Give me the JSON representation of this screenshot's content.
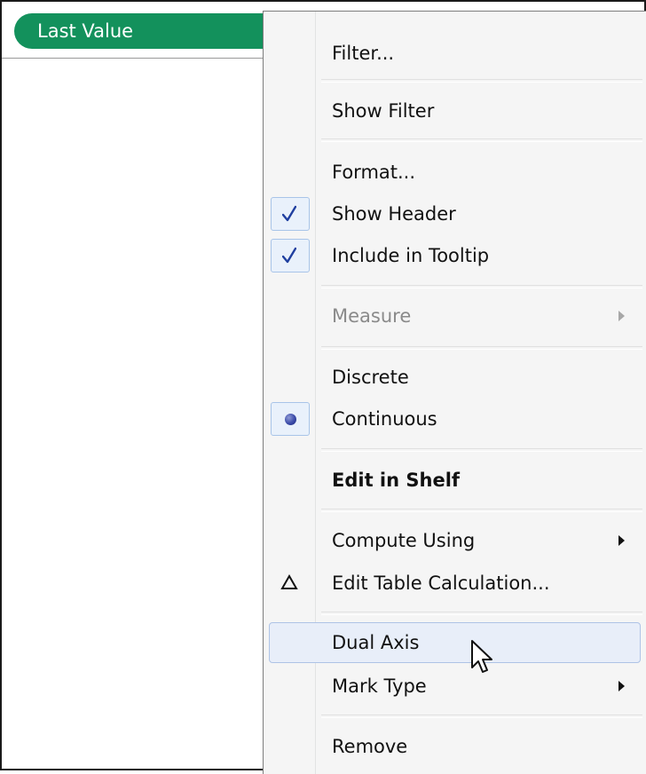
{
  "shelf": {
    "pill_label": "Last Value",
    "pill_color": "#13915c"
  },
  "menu": {
    "items": [
      {
        "label": "Filter..."
      },
      {
        "label": "Show Filter"
      },
      {
        "label": "Format..."
      },
      {
        "label": "Show Header",
        "checked": true,
        "icon": "check-icon"
      },
      {
        "label": "Include in Tooltip",
        "checked": true,
        "icon": "check-icon"
      },
      {
        "label": "Measure",
        "disabled": true,
        "submenu": true
      },
      {
        "label": "Discrete"
      },
      {
        "label": "Continuous",
        "selected": true,
        "icon": "radio-icon"
      },
      {
        "label": "Edit in Shelf",
        "bold": true
      },
      {
        "label": "Compute Using",
        "submenu": true
      },
      {
        "label": "Edit Table Calculation...",
        "icon": "delta-icon"
      },
      {
        "label": "Dual Axis",
        "hovered": true
      },
      {
        "label": "Mark Type",
        "submenu": true
      },
      {
        "label": "Remove"
      }
    ],
    "hover_color": "#e8eef9",
    "check_color": "#1f3fa0"
  },
  "cursor": {
    "icon": "arrow-cursor-icon"
  }
}
